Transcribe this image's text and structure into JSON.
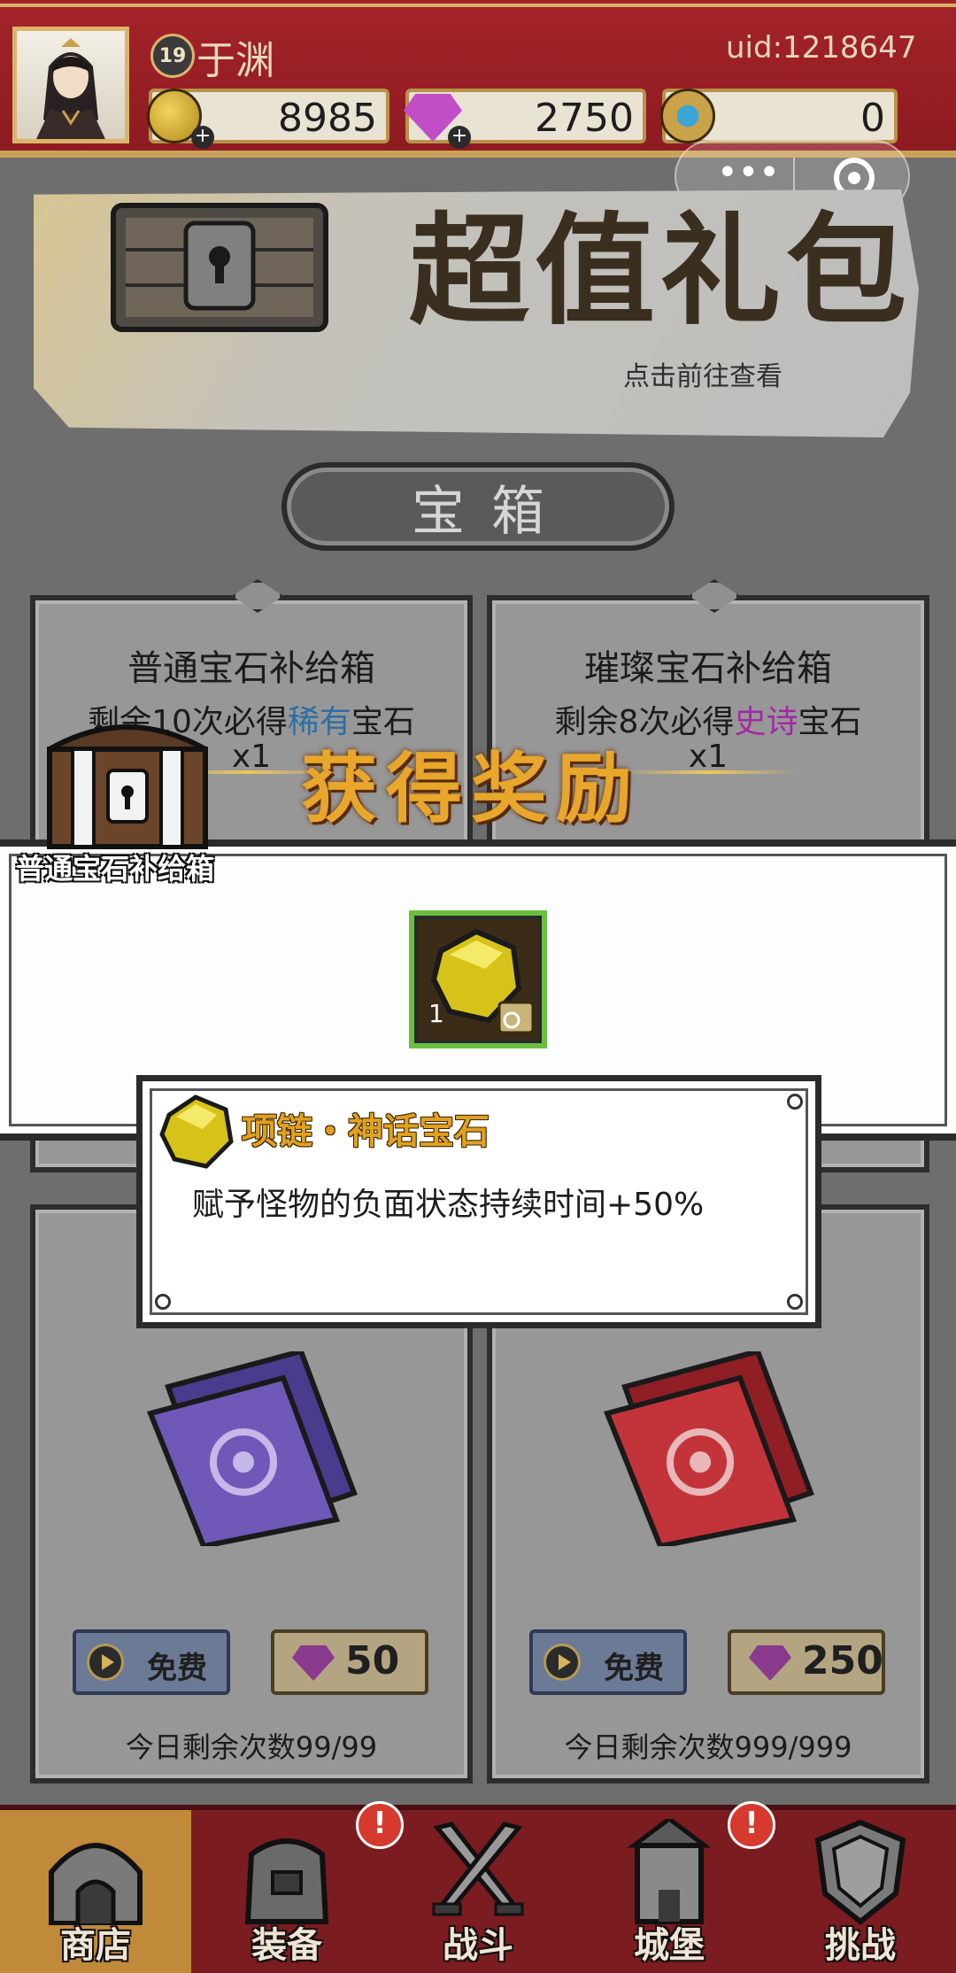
{
  "header": {
    "level": "19",
    "player_name": "于渊",
    "uid": "uid:1218647",
    "currencies": [
      {
        "icon": "gold-coin-icon",
        "value": "8985"
      },
      {
        "icon": "purple-gem-icon",
        "value": "2750"
      },
      {
        "icon": "blue-crystal-coin-icon",
        "value": "0"
      }
    ],
    "plus_glyph": "+"
  },
  "capsule": {
    "more_glyph": "•••",
    "more_icon": "more-icon",
    "close_icon": "close-mini-program-icon"
  },
  "banner": {
    "title": "超值礼包",
    "hint": "点击前往查看"
  },
  "section": {
    "title": "宝箱"
  },
  "cards": [
    {
      "title": "普通宝石补给箱",
      "sub_prefix": "剩余10次必得",
      "sub_highlight": "稀有",
      "sub_suffix": "宝石",
      "count": "x1"
    },
    {
      "title": "璀璨宝石补给箱",
      "sub_prefix": "剩余8次必得",
      "sub_highlight": "史诗",
      "sub_suffix": "宝石",
      "count": "x1"
    },
    {
      "free_label": "免费",
      "gem_price": "50",
      "remaining": "今日剩余次数99/99"
    },
    {
      "free_label": "免费",
      "gem_price": "250",
      "remaining": "今日剩余次数999/999"
    }
  ],
  "reward": {
    "title": "获得奖励",
    "chest_label": "普通宝石补给箱",
    "item_count": "1",
    "item_name": "项链・神话宝石",
    "item_desc": "赋予怪物的负面状态持续时间+50%"
  },
  "bottom_nav": [
    {
      "label": "商店",
      "icon": "shop-icon",
      "active": true,
      "alert": false
    },
    {
      "label": "装备",
      "icon": "equipment-bag-icon",
      "active": false,
      "alert": true
    },
    {
      "label": "战斗",
      "icon": "crossed-swords-icon",
      "active": false,
      "alert": false
    },
    {
      "label": "城堡",
      "icon": "castle-icon",
      "active": false,
      "alert": true
    },
    {
      "label": "挑战",
      "icon": "shield-icon",
      "active": false,
      "alert": false
    }
  ],
  "alert_glyph": "!",
  "colors": {
    "header_red": "#8d1b21",
    "gold": "#c9a25a",
    "rare_blue": "#2d6ea6",
    "epic_purple": "#a12aa6",
    "reward_gold": "#e8a62b"
  }
}
